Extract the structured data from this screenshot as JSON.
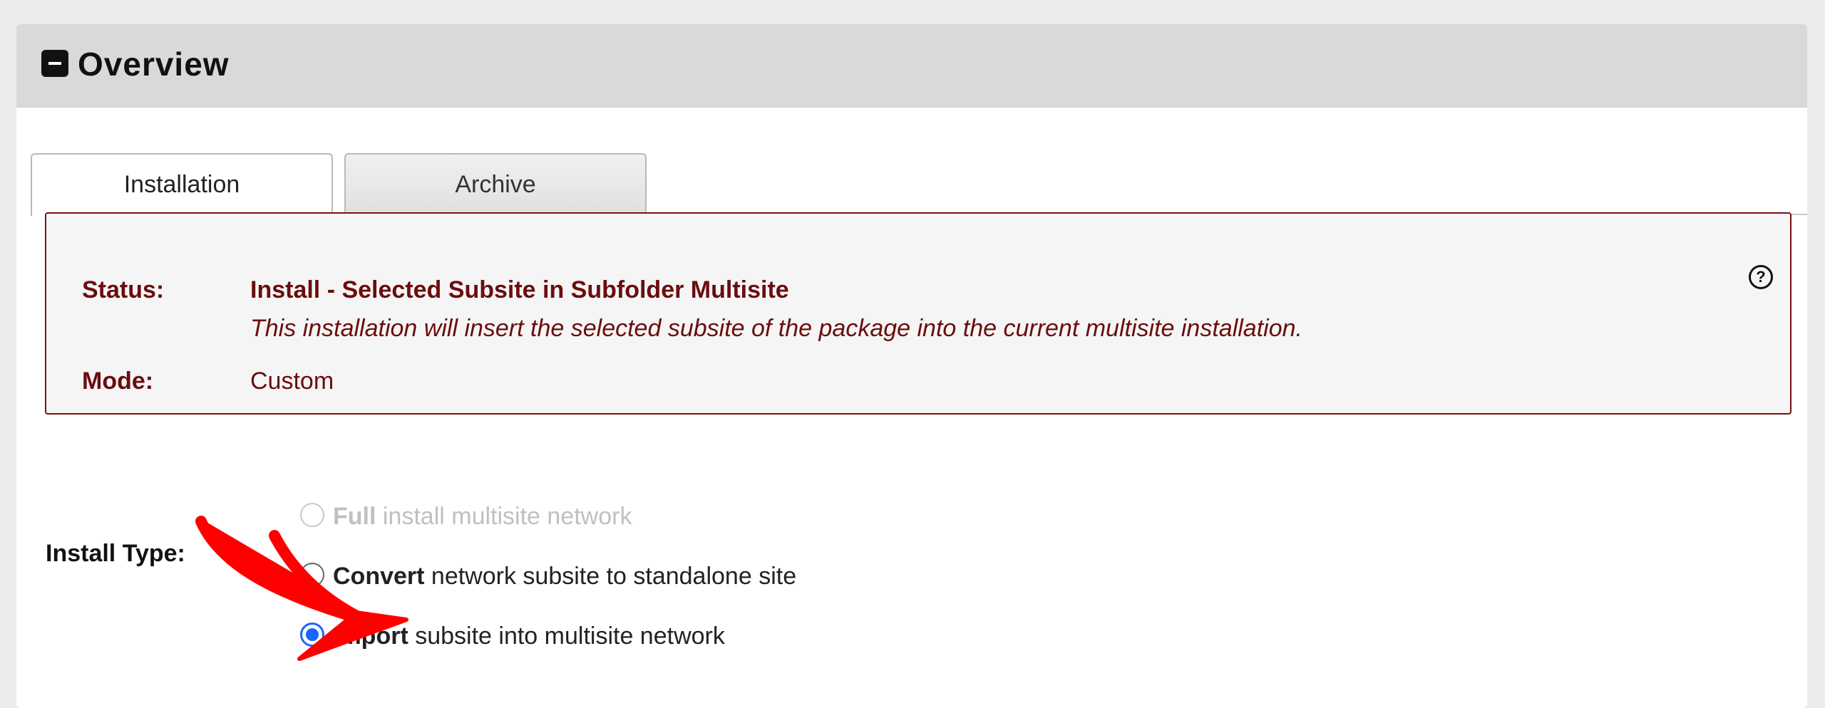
{
  "panel": {
    "title": "Overview"
  },
  "tabs": [
    {
      "label": "Installation",
      "active": true
    },
    {
      "label": "Archive",
      "active": false
    }
  ],
  "status": {
    "status_label": "Status:",
    "status_title": "Install - Selected Subsite in Subfolder Multisite",
    "status_desc": "This installation will insert the selected subsite of the package into the current multisite installation.",
    "mode_label": "Mode:",
    "mode_value": "Custom",
    "help_glyph": "?"
  },
  "install_type": {
    "label": "Install Type:",
    "options": [
      {
        "strong": "Full",
        "rest": " install multisite network",
        "state": "disabled"
      },
      {
        "strong": "Convert",
        "rest": " network subsite to standalone site",
        "state": "unchecked"
      },
      {
        "strong": "Import",
        "rest": " subsite into multisite network",
        "state": "checked"
      }
    ]
  },
  "colors": {
    "accent": "#1a66ff",
    "status_text": "#6b0d0d",
    "annotation_arrow": "#ff0000"
  },
  "icons": [
    "collapse-minus-icon",
    "help-circle-icon",
    "red-arrow-annotation"
  ]
}
